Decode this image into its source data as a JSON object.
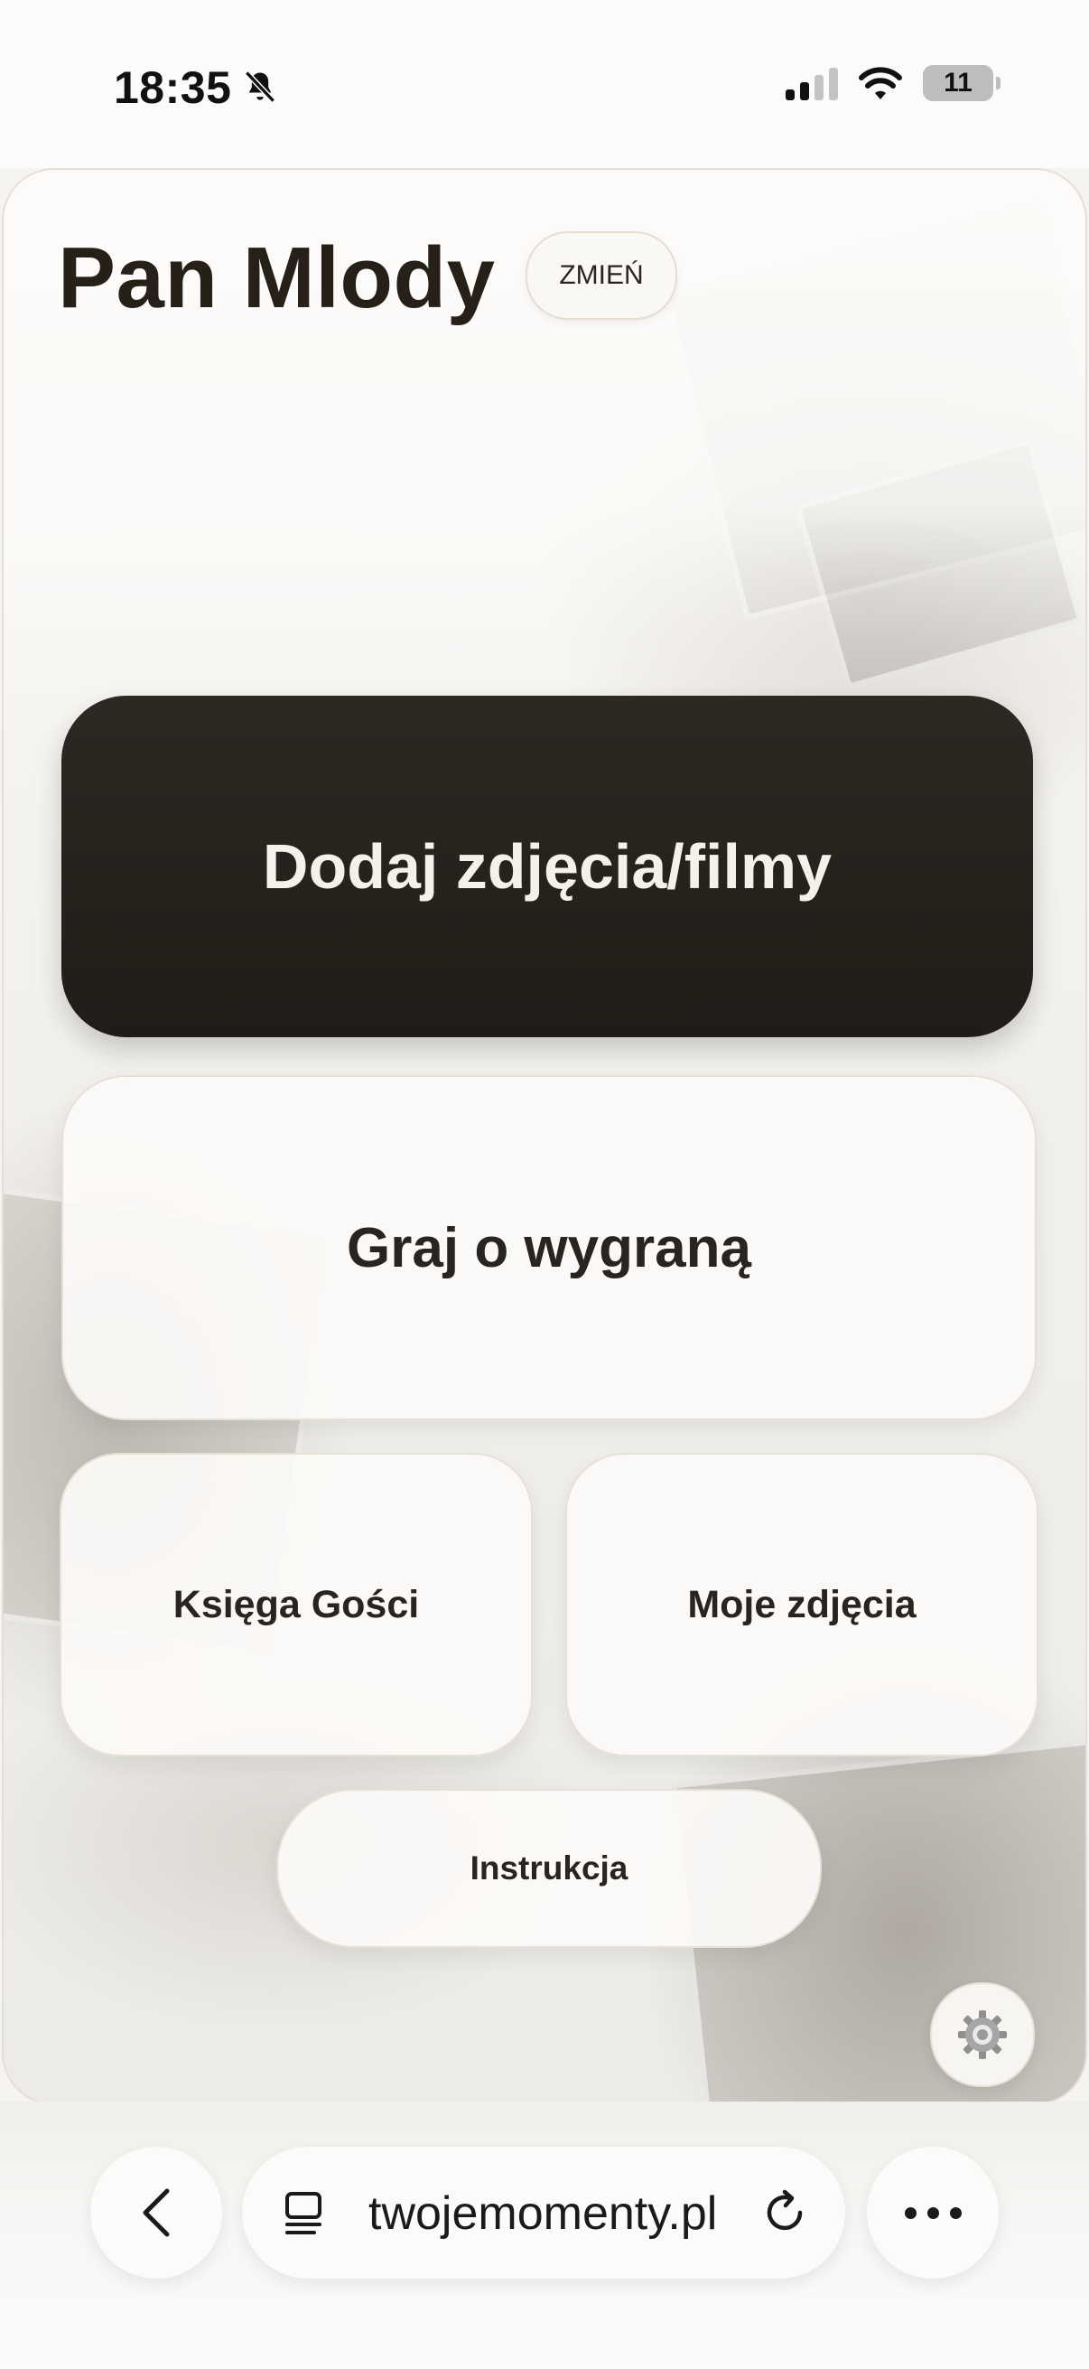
{
  "status_bar": {
    "time": "18:35",
    "battery": "11",
    "icons": [
      "bell-slash-icon",
      "cellular-signal-icon",
      "wifi-icon",
      "battery-icon"
    ]
  },
  "header": {
    "title": "Pan Mlody",
    "change_label": "ZMIEŃ"
  },
  "actions": {
    "add_media": "Dodaj zdjęcia/filmy",
    "play": "Graj o wygraną",
    "guestbook": "Księga Gości",
    "my_photos": "Moje zdjęcia",
    "instructions": "Instrukcja"
  },
  "browser": {
    "url": "twojemomenty.pl",
    "icons": [
      "back-chevron-icon",
      "tabs-icon",
      "reload-icon",
      "more-icon"
    ]
  },
  "colors": {
    "primary_button": "#262019",
    "primary_text": "#f5f1ea",
    "light_button": "#fcfaf7",
    "border": "#e7e0d5",
    "text": "#2a2420"
  }
}
